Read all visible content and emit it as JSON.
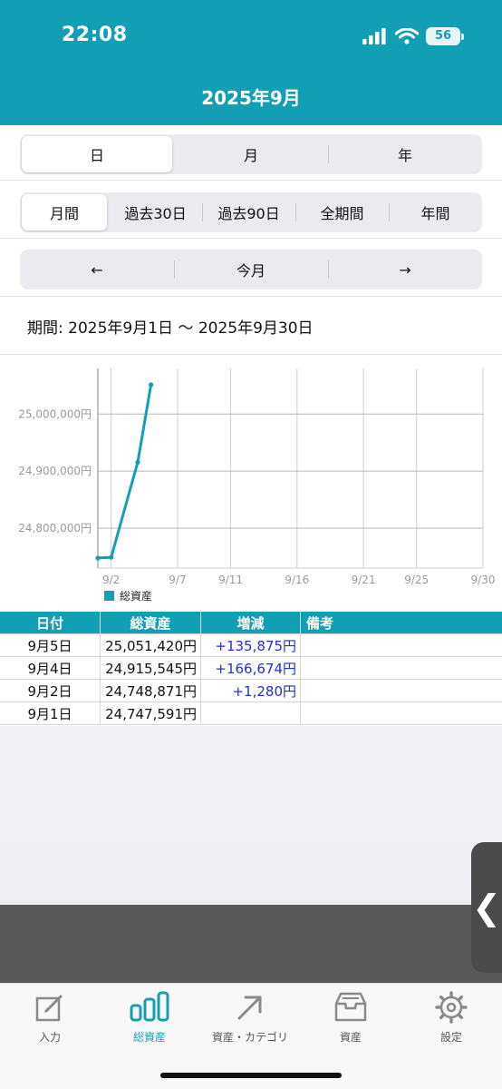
{
  "status": {
    "time": "22:08",
    "battery": "56"
  },
  "header": {
    "title": "2025年9月"
  },
  "granularity": {
    "items": [
      "日",
      "月",
      "年"
    ],
    "active": 0
  },
  "range": {
    "items": [
      "月間",
      "過去30日",
      "過去90日",
      "全期間",
      "年間"
    ],
    "active": 0
  },
  "nav": {
    "prev": "←",
    "current": "今月",
    "next": "→"
  },
  "period": {
    "text": "期間: 2025年9月1日 〜 2025年9月30日"
  },
  "colors": {
    "accent": "#129fb6",
    "positive": "#1f2fd0"
  },
  "chart_data": {
    "type": "line",
    "series": [
      {
        "name": "総資産",
        "x": [
          "9/1",
          "9/2",
          "9/4",
          "9/5"
        ],
        "x_day": [
          1,
          2,
          4,
          5
        ],
        "values": [
          24747591,
          24748871,
          24915545,
          25051420
        ]
      }
    ],
    "y_ticks": [
      24800000,
      24900000,
      25000000
    ],
    "y_tick_labels": [
      "24,800,000円",
      "24,900,000円",
      "25,000,000円"
    ],
    "x_ticks": [
      2,
      7,
      11,
      16,
      21,
      25,
      30
    ],
    "x_tick_labels": [
      "9/2",
      "9/7",
      "9/11",
      "9/16",
      "9/21",
      "9/25",
      "9/30"
    ],
    "xlim": [
      1,
      30
    ],
    "ylim": [
      24730000,
      25080000
    ],
    "grid": true,
    "legend": "bottom-left",
    "legend_label": "総資産"
  },
  "table": {
    "headers": [
      "日付",
      "総資産",
      "増減",
      "備考"
    ],
    "rows": [
      [
        "9月5日",
        "25,051,420円",
        "+135,875円",
        ""
      ],
      [
        "9月4日",
        "24,915,545円",
        "+166,674円",
        ""
      ],
      [
        "9月2日",
        "24,748,871円",
        "+1,280円",
        ""
      ],
      [
        "9月1日",
        "24,747,591円",
        "",
        ""
      ]
    ]
  },
  "side_handle": {
    "label": "❮"
  },
  "tabbar": {
    "items": [
      {
        "label": "入力",
        "icon": "edit-icon"
      },
      {
        "label": "総資産",
        "icon": "bar-chart-icon"
      },
      {
        "label": "資産・カテゴリ",
        "icon": "arrow-up-right-icon"
      },
      {
        "label": "資産",
        "icon": "tray-icon"
      },
      {
        "label": "設定",
        "icon": "gear-icon"
      }
    ],
    "active": 1
  }
}
